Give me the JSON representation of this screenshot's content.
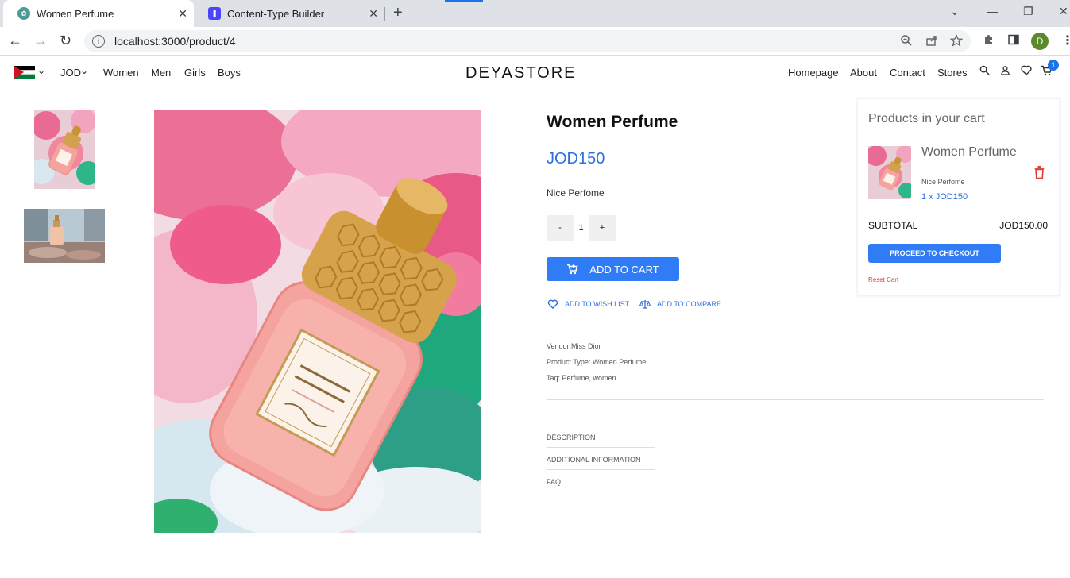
{
  "browser": {
    "tabs": [
      {
        "title": "Women Perfume",
        "active": true
      },
      {
        "title": "Content-Type Builder",
        "active": false
      }
    ],
    "url": "localhost:3000/product/4",
    "profile_initial": "D"
  },
  "header": {
    "currency": "JOD",
    "nav_left": [
      "Women",
      "Men",
      "Girls",
      "Boys"
    ],
    "brand": "DEYASTORE",
    "nav_right": [
      "Homepage",
      "About",
      "Contact",
      "Stores"
    ],
    "cart_count": "1"
  },
  "product": {
    "title": "Women Perfume",
    "price": "JOD150",
    "description": "Nice Perfome",
    "qty_minus": "-",
    "quantity": "1",
    "qty_plus": "+",
    "add_to_cart": "ADD TO CART",
    "add_to_wishlist": "ADD TO WISH LIST",
    "add_to_compare": "ADD TO COMPARE",
    "vendor": "Vendor:Miss Dior",
    "product_type": "Product Type: Women Perfume",
    "tags": "Taq: Perfume, women",
    "accordion": [
      "DESCRIPTION",
      "ADDITIONAL INFORMATION",
      "FAQ"
    ]
  },
  "cart": {
    "title": "Products in your cart",
    "item_name": "Women Perfume",
    "item_desc": "Nice Perfome",
    "item_qty_price": "1 x JOD150",
    "subtotal_label": "SUBTOTAL",
    "subtotal_value": "JOD150.00",
    "checkout_label": "PROCEED TO CHECKOUT",
    "reset_label": "Reset Cart"
  },
  "colors": {
    "accent": "#2f7cf6",
    "price": "#2f6fe0",
    "danger": "#e53935"
  }
}
